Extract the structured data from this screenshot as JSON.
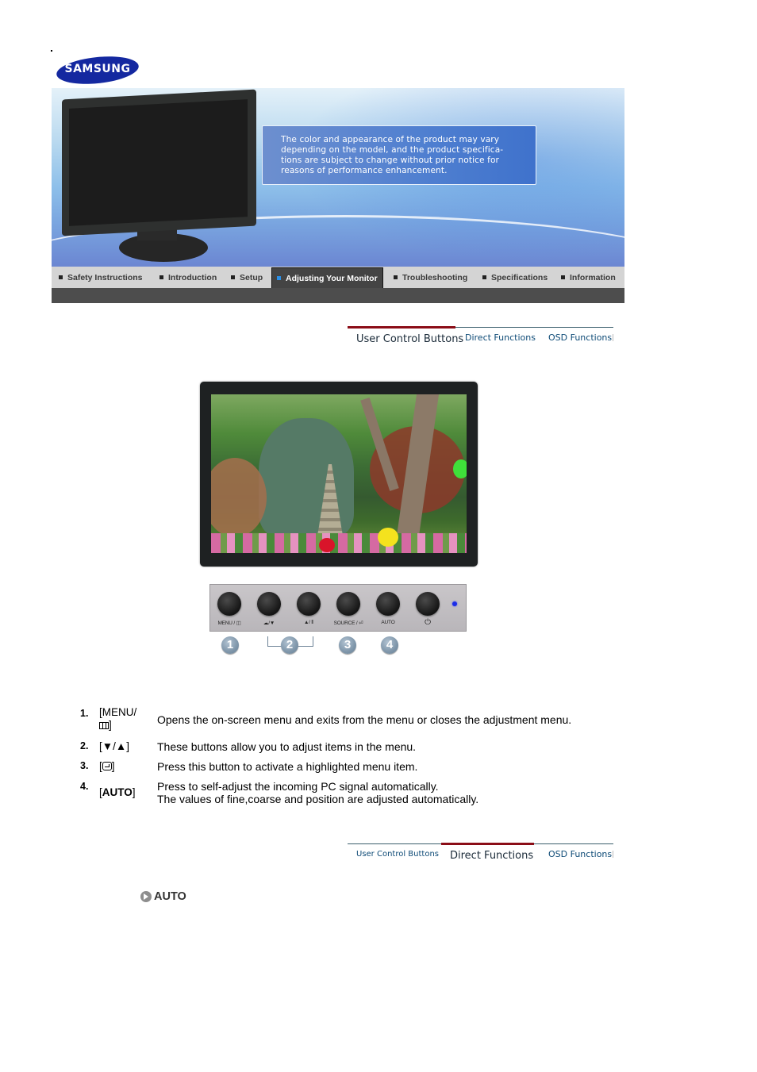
{
  "brand": {
    "logo_text": "SAMSUNG"
  },
  "banner": {
    "notice_lines": [
      "The color and appearance of the product may vary",
      "depending on the model, and the product specifica-",
      "tions are subject to change without prior notice for",
      "reasons of performance enhancement."
    ]
  },
  "nav": {
    "items": [
      {
        "label": "Safety Instructions",
        "active": false
      },
      {
        "label": "Introduction",
        "active": false
      },
      {
        "label": "Setup",
        "active": false
      },
      {
        "label": "Adjusting Your Monitor",
        "active": true
      },
      {
        "label": "Troubleshooting",
        "active": false
      },
      {
        "label": "Specifications",
        "active": false
      },
      {
        "label": "Information",
        "active": false
      }
    ],
    "active_color": "#2b8fe6"
  },
  "tabs_top": {
    "items": [
      {
        "label": "User Control Buttons",
        "active": true
      },
      {
        "label": "Direct Functions",
        "active": false
      },
      {
        "label": "OSD Functions",
        "active": false
      }
    ],
    "active_color": "#8b0d17"
  },
  "panel": {
    "buttons": [
      {
        "label": "MENU / ◫"
      },
      {
        "label": "☁/▼"
      },
      {
        "label": "▲/ ⦀"
      },
      {
        "label": "SOURCE / ⏎"
      },
      {
        "label": "AUTO"
      },
      {
        "label": "⏻"
      }
    ],
    "badges": [
      "1",
      "2",
      "3",
      "4"
    ],
    "led_color": "#1b2de8"
  },
  "instructions": [
    {
      "num": "1.",
      "key_line1": "[MENU/",
      "key_line2": "]",
      "desc": "Opens the on-screen menu and exits from the menu or closes the adjustment menu."
    },
    {
      "num": "2.",
      "key": "[▼/▲]",
      "desc": "These buttons allow you to adjust items in the menu."
    },
    {
      "num": "3.",
      "key_open": "[",
      "key_close": "]",
      "desc": "Press this button to activate a highlighted menu item."
    },
    {
      "num": "4.",
      "key_open": "[",
      "key_bold": "AUTO",
      "key_close": "]",
      "desc_line1": "Press to self-adjust the incoming PC signal automatically.",
      "desc_line2": "The values of fine,coarse and position are adjusted automatically."
    }
  ],
  "tabs_bottom": {
    "items": [
      {
        "label": "User Control Buttons",
        "active": false
      },
      {
        "label": "Direct Functions",
        "active": true
      },
      {
        "label": "OSD Functions",
        "active": false
      }
    ]
  },
  "section": {
    "heading": "AUTO"
  }
}
